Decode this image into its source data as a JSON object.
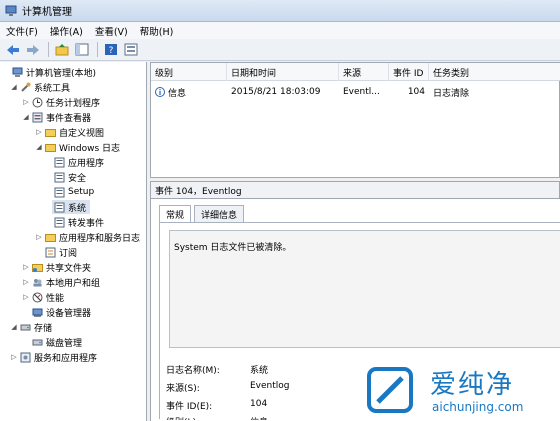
{
  "window": {
    "title": "计算机管理"
  },
  "menu": [
    "文件(F)",
    "操作(A)",
    "查看(V)",
    "帮助(H)"
  ],
  "toolbar": {
    "icons": [
      "back-arrow-icon",
      "forward-arrow-icon",
      "up-folder-icon",
      "show-hide-tree-icon",
      "help-icon",
      "properties-icon"
    ]
  },
  "tree": [
    {
      "label": "计算机管理(本地)",
      "icon": "computer-icon"
    },
    {
      "label": "系统工具",
      "icon": "tools-icon"
    },
    {
      "label": "任务计划程序",
      "icon": "clock-icon"
    },
    {
      "label": "事件查看器",
      "icon": "event-viewer-icon"
    },
    {
      "label": "自定义视图",
      "icon": "folder-icon"
    },
    {
      "label": "Windows 日志",
      "icon": "folder-icon"
    },
    {
      "label": "应用程序",
      "icon": "log-icon"
    },
    {
      "label": "安全",
      "icon": "log-icon"
    },
    {
      "label": "Setup",
      "icon": "log-icon"
    },
    {
      "label": "系统",
      "icon": "log-icon"
    },
    {
      "label": "转发事件",
      "icon": "log-icon"
    },
    {
      "label": "应用程序和服务日志",
      "icon": "folder-icon"
    },
    {
      "label": "订阅",
      "icon": "subscription-icon"
    },
    {
      "label": "共享文件夹",
      "icon": "shared-folder-icon"
    },
    {
      "label": "本地用户和组",
      "icon": "users-icon"
    },
    {
      "label": "性能",
      "icon": "performance-icon"
    },
    {
      "label": "设备管理器",
      "icon": "device-manager-icon"
    },
    {
      "label": "存储",
      "icon": "storage-icon"
    },
    {
      "label": "磁盘管理",
      "icon": "disk-icon"
    },
    {
      "label": "服务和应用程序",
      "icon": "services-icon"
    }
  ],
  "grid": {
    "columns": [
      "级别",
      "日期和时间",
      "来源",
      "事件 ID",
      "任务类别"
    ],
    "rows": [
      {
        "level": "信息",
        "datetime": "2015/8/21 18:03:09",
        "source": "Eventl...",
        "event_id": "104",
        "category": "日志清除"
      }
    ]
  },
  "detail": {
    "title": "事件 104，Eventlog",
    "tabs": [
      "常规",
      "详细信息"
    ],
    "description": "System 日志文件已被清除。",
    "properties": [
      {
        "label": "日志名称(M):",
        "value": "系统"
      },
      {
        "label": "来源(S):",
        "value": "Eventlog"
      },
      {
        "label": "事件 ID(E):",
        "value": "104"
      },
      {
        "label": "级别(L):",
        "value": "信息"
      }
    ]
  },
  "watermark": {
    "brand": "爱纯净",
    "url": "aichunjing.com"
  }
}
